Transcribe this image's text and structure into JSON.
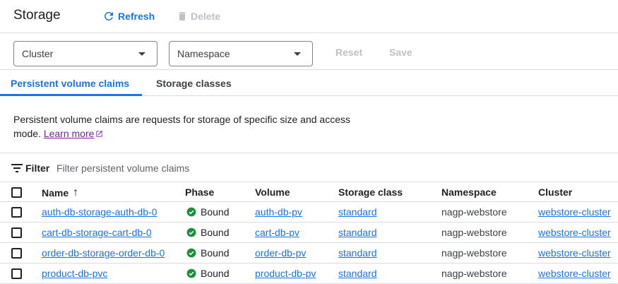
{
  "header": {
    "title": "Storage",
    "refresh_label": "Refresh",
    "delete_label": "Delete"
  },
  "filters": {
    "cluster_label": "Cluster",
    "namespace_label": "Namespace",
    "reset_label": "Reset",
    "save_label": "Save"
  },
  "tabs": [
    {
      "label": "Persistent volume claims",
      "active": true
    },
    {
      "label": "Storage classes",
      "active": false
    }
  ],
  "description": {
    "text": "Persistent volume claims are requests for storage of specific size and access mode.",
    "link_label": "Learn more"
  },
  "filter_bar": {
    "label": "Filter",
    "placeholder": "Filter persistent volume claims"
  },
  "table": {
    "columns": [
      "Name",
      "Phase",
      "Volume",
      "Storage class",
      "Namespace",
      "Cluster"
    ],
    "sort_indicator": "↑",
    "rows": [
      {
        "name": "auth-db-storage-auth-db-0",
        "phase": "Bound",
        "volume": "auth-db-pv",
        "storage_class": "standard",
        "namespace": "nagp-webstore",
        "cluster": "webstore-cluster"
      },
      {
        "name": "cart-db-storage-cart-db-0",
        "phase": "Bound",
        "volume": "cart-db-pv",
        "storage_class": "standard",
        "namespace": "nagp-webstore",
        "cluster": "webstore-cluster"
      },
      {
        "name": "order-db-storage-order-db-0",
        "phase": "Bound",
        "volume": "order-db-pv",
        "storage_class": "standard",
        "namespace": "nagp-webstore",
        "cluster": "webstore-cluster"
      },
      {
        "name": "product-db-pvc",
        "phase": "Bound",
        "volume": "product-db-pv",
        "storage_class": "standard",
        "namespace": "nagp-webstore",
        "cluster": "webstore-cluster"
      }
    ]
  },
  "colors": {
    "accent": "#1a73e8",
    "success": "#1e8e3e",
    "disabled": "#bdc1c6",
    "link_visited": "#7b1fa2"
  },
  "icons": {
    "refresh": "refresh-icon",
    "delete": "trash-icon",
    "dropdown": "caret-down-icon",
    "external": "external-link-icon",
    "filter": "filter-lines-icon",
    "sort": "arrow-up-icon",
    "status": "check-circle-icon"
  }
}
